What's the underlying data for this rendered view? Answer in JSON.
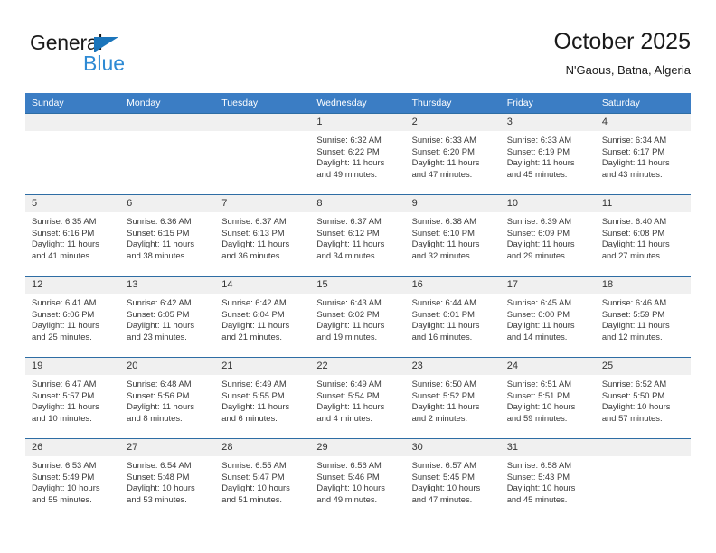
{
  "logo": {
    "word_one": "General",
    "word_two": "Blue",
    "triangle_color": "#1b75bb",
    "blue_color": "#2e8ad4"
  },
  "header": {
    "title": "October 2025",
    "subtitle": "N'Gaous, Batna, Algeria"
  },
  "theme": {
    "header_row_bg": "#3b7dc4",
    "header_row_text": "#ffffff",
    "daynum_bg": "#f0f0f0",
    "cell_border": "#2e6da4",
    "body_text": "#3a3a3a"
  },
  "calendar": {
    "weekday_headers": [
      "Sunday",
      "Monday",
      "Tuesday",
      "Wednesday",
      "Thursday",
      "Friday",
      "Saturday"
    ],
    "labels": {
      "sunrise_prefix": "Sunrise:",
      "sunset_prefix": "Sunset:",
      "daylight_prefix": "Daylight:"
    },
    "weeks": [
      [
        {
          "day": "",
          "empty": true,
          "line1": "",
          "line2": "",
          "line3": "",
          "line4": ""
        },
        {
          "day": "",
          "empty": true,
          "line1": "",
          "line2": "",
          "line3": "",
          "line4": ""
        },
        {
          "day": "",
          "empty": true,
          "line1": "",
          "line2": "",
          "line3": "",
          "line4": ""
        },
        {
          "day": "1",
          "empty": false,
          "line1": "Sunrise: 6:32 AM",
          "line2": "Sunset: 6:22 PM",
          "line3": "Daylight: 11 hours",
          "line4": "and 49 minutes."
        },
        {
          "day": "2",
          "empty": false,
          "line1": "Sunrise: 6:33 AM",
          "line2": "Sunset: 6:20 PM",
          "line3": "Daylight: 11 hours",
          "line4": "and 47 minutes."
        },
        {
          "day": "3",
          "empty": false,
          "line1": "Sunrise: 6:33 AM",
          "line2": "Sunset: 6:19 PM",
          "line3": "Daylight: 11 hours",
          "line4": "and 45 minutes."
        },
        {
          "day": "4",
          "empty": false,
          "line1": "Sunrise: 6:34 AM",
          "line2": "Sunset: 6:17 PM",
          "line3": "Daylight: 11 hours",
          "line4": "and 43 minutes."
        }
      ],
      [
        {
          "day": "5",
          "empty": false,
          "line1": "Sunrise: 6:35 AM",
          "line2": "Sunset: 6:16 PM",
          "line3": "Daylight: 11 hours",
          "line4": "and 41 minutes."
        },
        {
          "day": "6",
          "empty": false,
          "line1": "Sunrise: 6:36 AM",
          "line2": "Sunset: 6:15 PM",
          "line3": "Daylight: 11 hours",
          "line4": "and 38 minutes."
        },
        {
          "day": "7",
          "empty": false,
          "line1": "Sunrise: 6:37 AM",
          "line2": "Sunset: 6:13 PM",
          "line3": "Daylight: 11 hours",
          "line4": "and 36 minutes."
        },
        {
          "day": "8",
          "empty": false,
          "line1": "Sunrise: 6:37 AM",
          "line2": "Sunset: 6:12 PM",
          "line3": "Daylight: 11 hours",
          "line4": "and 34 minutes."
        },
        {
          "day": "9",
          "empty": false,
          "line1": "Sunrise: 6:38 AM",
          "line2": "Sunset: 6:10 PM",
          "line3": "Daylight: 11 hours",
          "line4": "and 32 minutes."
        },
        {
          "day": "10",
          "empty": false,
          "line1": "Sunrise: 6:39 AM",
          "line2": "Sunset: 6:09 PM",
          "line3": "Daylight: 11 hours",
          "line4": "and 29 minutes."
        },
        {
          "day": "11",
          "empty": false,
          "line1": "Sunrise: 6:40 AM",
          "line2": "Sunset: 6:08 PM",
          "line3": "Daylight: 11 hours",
          "line4": "and 27 minutes."
        }
      ],
      [
        {
          "day": "12",
          "empty": false,
          "line1": "Sunrise: 6:41 AM",
          "line2": "Sunset: 6:06 PM",
          "line3": "Daylight: 11 hours",
          "line4": "and 25 minutes."
        },
        {
          "day": "13",
          "empty": false,
          "line1": "Sunrise: 6:42 AM",
          "line2": "Sunset: 6:05 PM",
          "line3": "Daylight: 11 hours",
          "line4": "and 23 minutes."
        },
        {
          "day": "14",
          "empty": false,
          "line1": "Sunrise: 6:42 AM",
          "line2": "Sunset: 6:04 PM",
          "line3": "Daylight: 11 hours",
          "line4": "and 21 minutes."
        },
        {
          "day": "15",
          "empty": false,
          "line1": "Sunrise: 6:43 AM",
          "line2": "Sunset: 6:02 PM",
          "line3": "Daylight: 11 hours",
          "line4": "and 19 minutes."
        },
        {
          "day": "16",
          "empty": false,
          "line1": "Sunrise: 6:44 AM",
          "line2": "Sunset: 6:01 PM",
          "line3": "Daylight: 11 hours",
          "line4": "and 16 minutes."
        },
        {
          "day": "17",
          "empty": false,
          "line1": "Sunrise: 6:45 AM",
          "line2": "Sunset: 6:00 PM",
          "line3": "Daylight: 11 hours",
          "line4": "and 14 minutes."
        },
        {
          "day": "18",
          "empty": false,
          "line1": "Sunrise: 6:46 AM",
          "line2": "Sunset: 5:59 PM",
          "line3": "Daylight: 11 hours",
          "line4": "and 12 minutes."
        }
      ],
      [
        {
          "day": "19",
          "empty": false,
          "line1": "Sunrise: 6:47 AM",
          "line2": "Sunset: 5:57 PM",
          "line3": "Daylight: 11 hours",
          "line4": "and 10 minutes."
        },
        {
          "day": "20",
          "empty": false,
          "line1": "Sunrise: 6:48 AM",
          "line2": "Sunset: 5:56 PM",
          "line3": "Daylight: 11 hours",
          "line4": "and 8 minutes."
        },
        {
          "day": "21",
          "empty": false,
          "line1": "Sunrise: 6:49 AM",
          "line2": "Sunset: 5:55 PM",
          "line3": "Daylight: 11 hours",
          "line4": "and 6 minutes."
        },
        {
          "day": "22",
          "empty": false,
          "line1": "Sunrise: 6:49 AM",
          "line2": "Sunset: 5:54 PM",
          "line3": "Daylight: 11 hours",
          "line4": "and 4 minutes."
        },
        {
          "day": "23",
          "empty": false,
          "line1": "Sunrise: 6:50 AM",
          "line2": "Sunset: 5:52 PM",
          "line3": "Daylight: 11 hours",
          "line4": "and 2 minutes."
        },
        {
          "day": "24",
          "empty": false,
          "line1": "Sunrise: 6:51 AM",
          "line2": "Sunset: 5:51 PM",
          "line3": "Daylight: 10 hours",
          "line4": "and 59 minutes."
        },
        {
          "day": "25",
          "empty": false,
          "line1": "Sunrise: 6:52 AM",
          "line2": "Sunset: 5:50 PM",
          "line3": "Daylight: 10 hours",
          "line4": "and 57 minutes."
        }
      ],
      [
        {
          "day": "26",
          "empty": false,
          "line1": "Sunrise: 6:53 AM",
          "line2": "Sunset: 5:49 PM",
          "line3": "Daylight: 10 hours",
          "line4": "and 55 minutes."
        },
        {
          "day": "27",
          "empty": false,
          "line1": "Sunrise: 6:54 AM",
          "line2": "Sunset: 5:48 PM",
          "line3": "Daylight: 10 hours",
          "line4": "and 53 minutes."
        },
        {
          "day": "28",
          "empty": false,
          "line1": "Sunrise: 6:55 AM",
          "line2": "Sunset: 5:47 PM",
          "line3": "Daylight: 10 hours",
          "line4": "and 51 minutes."
        },
        {
          "day": "29",
          "empty": false,
          "line1": "Sunrise: 6:56 AM",
          "line2": "Sunset: 5:46 PM",
          "line3": "Daylight: 10 hours",
          "line4": "and 49 minutes."
        },
        {
          "day": "30",
          "empty": false,
          "line1": "Sunrise: 6:57 AM",
          "line2": "Sunset: 5:45 PM",
          "line3": "Daylight: 10 hours",
          "line4": "and 47 minutes."
        },
        {
          "day": "31",
          "empty": false,
          "line1": "Sunrise: 6:58 AM",
          "line2": "Sunset: 5:43 PM",
          "line3": "Daylight: 10 hours",
          "line4": "and 45 minutes."
        },
        {
          "day": "",
          "empty": true,
          "line1": "",
          "line2": "",
          "line3": "",
          "line4": ""
        }
      ]
    ]
  }
}
